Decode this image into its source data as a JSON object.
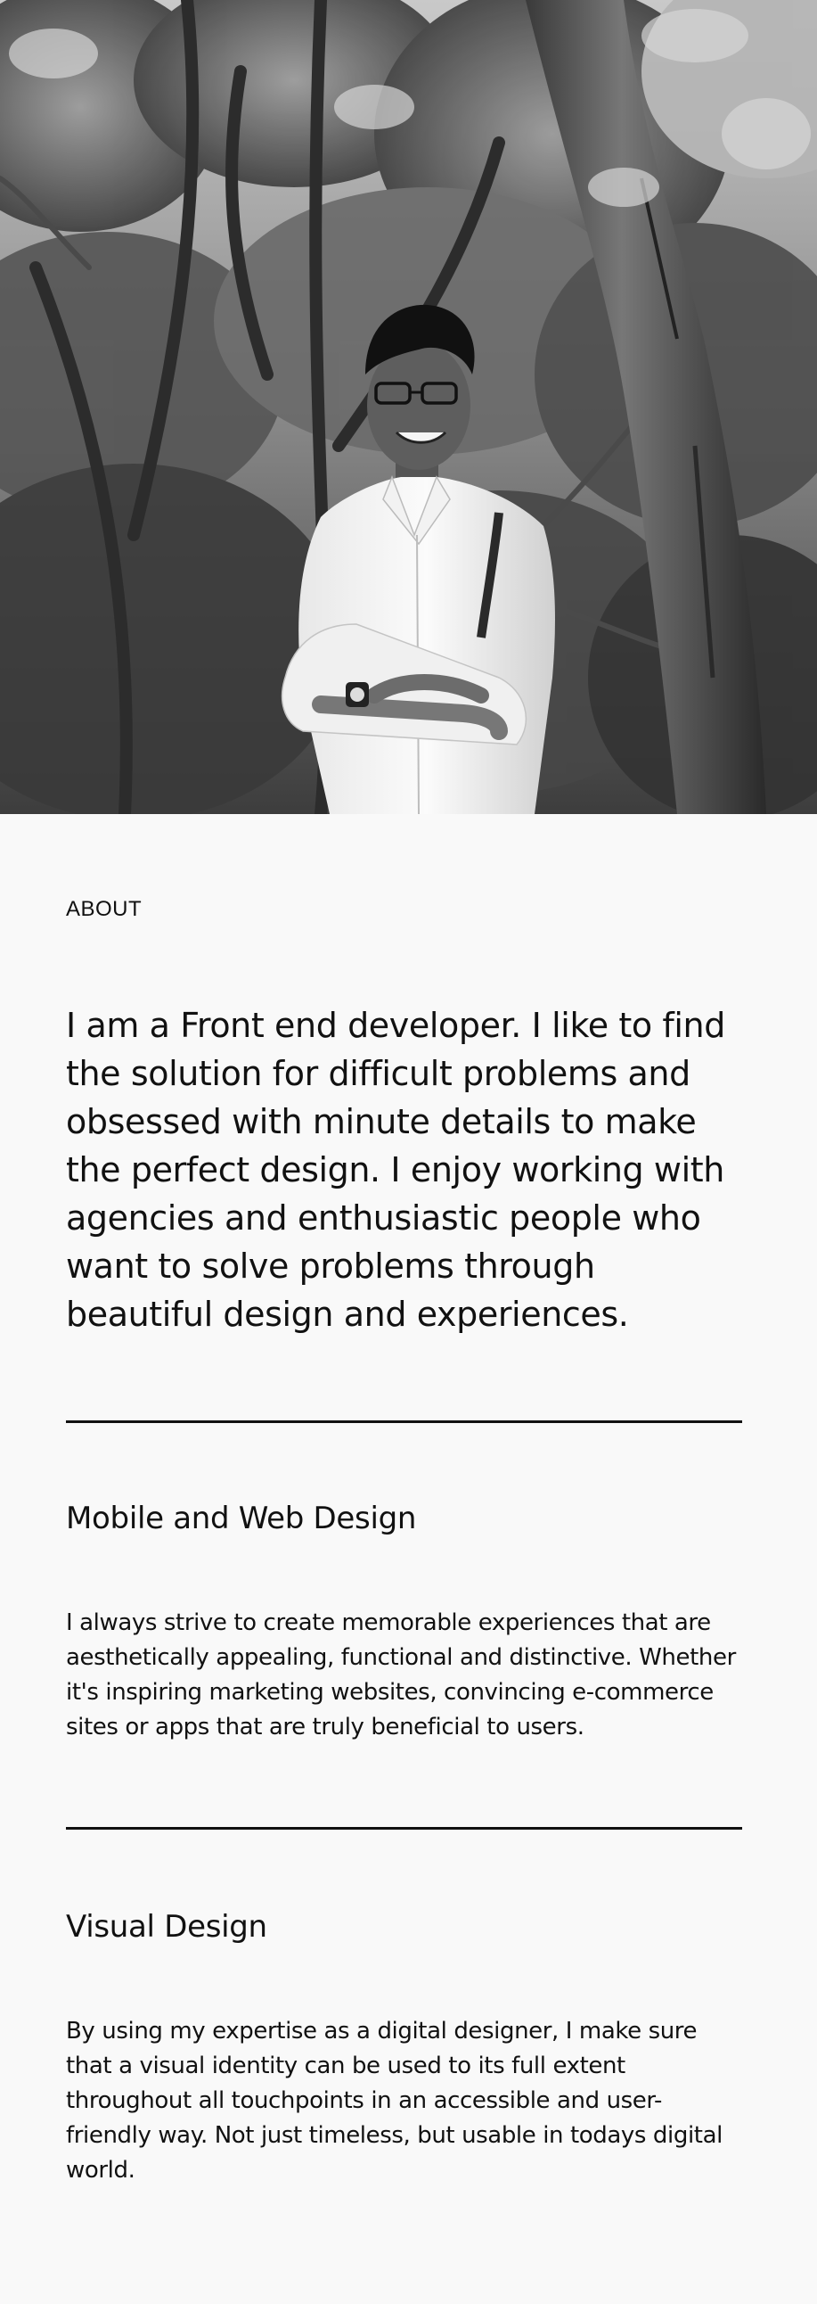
{
  "hero": {
    "image_name": "profile-photo"
  },
  "about": {
    "eyebrow": "ABOUT",
    "intro": "I am a Front end developer. I like to find the solution for difficult problems and obsessed with minute details to make the perfect design. I enjoy working with agencies and enthusiastic people who want to solve problems through beautiful design and experiences."
  },
  "sections": [
    {
      "title": "Mobile and Web Design",
      "body": "I always strive to create memorable experiences that are aesthetically appealing, functional and distinctive. Whether it's inspiring marketing websites, convincing e-commerce sites or apps that are truly beneficial to users."
    },
    {
      "title": "Visual Design",
      "body": "By using my expertise as a digital designer, I make sure that a visual identity can be used to its full extent throughout all touchpoints in an accessible and user-friendly way. Not just timeless, but usable in todays digital world."
    }
  ]
}
